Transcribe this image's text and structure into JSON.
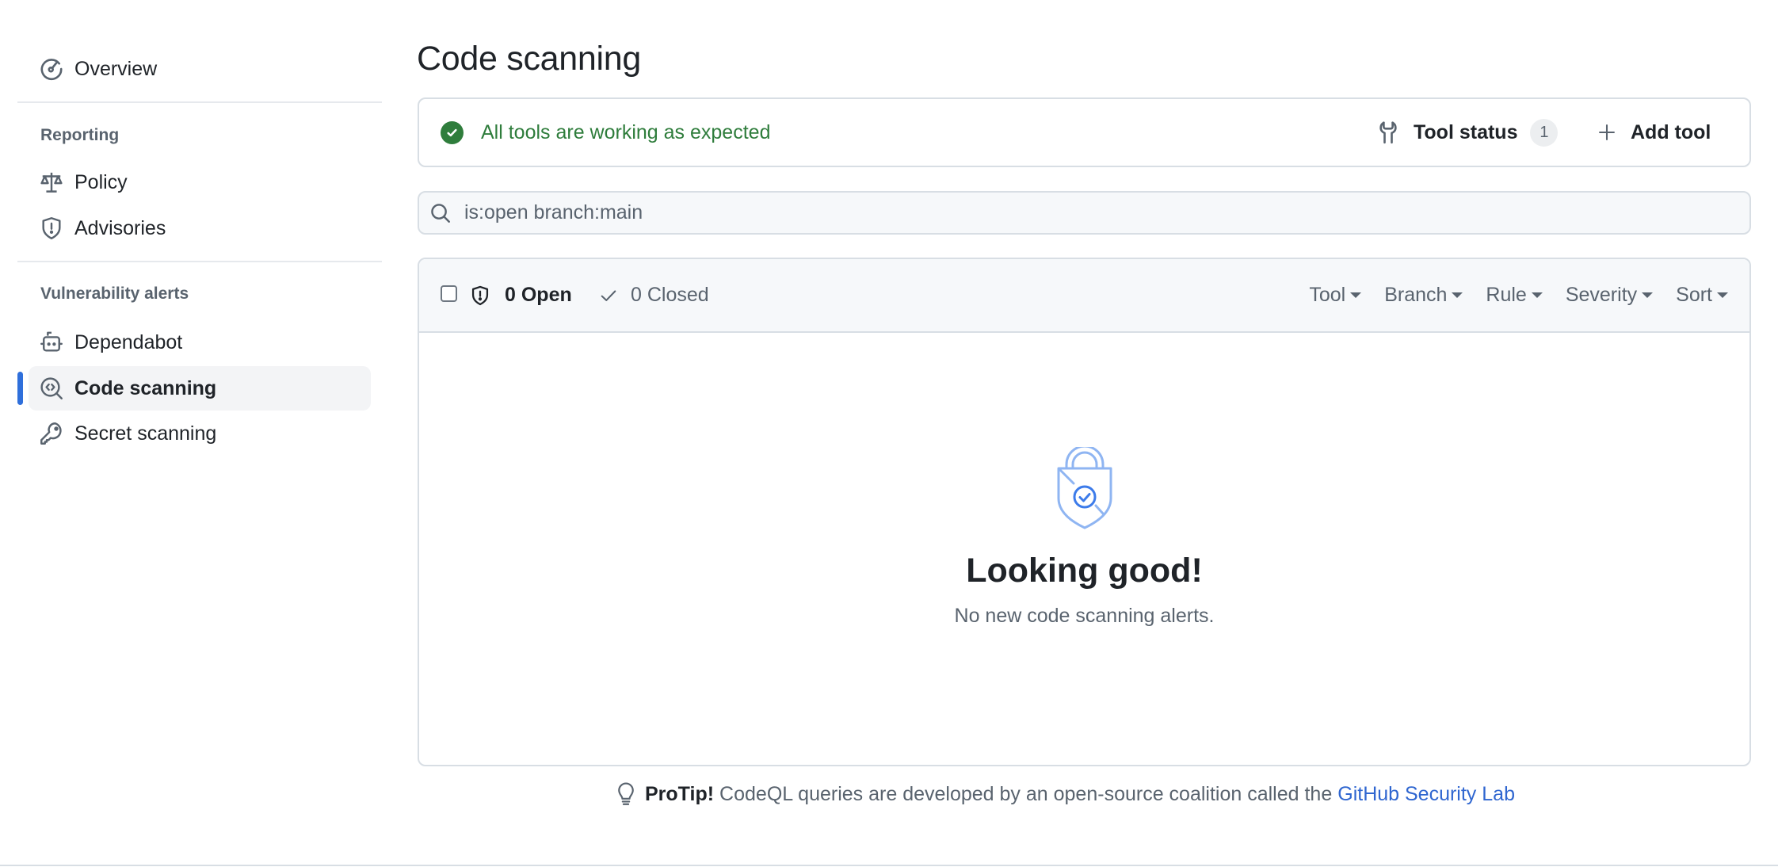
{
  "sidebar": {
    "overview": {
      "label": "Overview",
      "icon": "meter-icon"
    },
    "sections": [
      {
        "heading": "Reporting",
        "items": [
          {
            "label": "Policy",
            "icon": "law-icon"
          },
          {
            "label": "Advisories",
            "icon": "shield-alert-icon"
          }
        ]
      },
      {
        "heading": "Vulnerability alerts",
        "items": [
          {
            "label": "Dependabot",
            "icon": "dependabot-icon"
          },
          {
            "label": "Code scanning",
            "icon": "codescan-icon",
            "active": true
          },
          {
            "label": "Secret scanning",
            "icon": "key-icon"
          }
        ]
      }
    ]
  },
  "main": {
    "title": "Code scanning",
    "tools": {
      "status_text": "All tools are working as expected",
      "tool_status_label": "Tool status",
      "tool_status_count": "1",
      "add_tool_label": "Add tool"
    },
    "search": {
      "value": "is:open branch:main"
    },
    "alerts": {
      "open_label": "0 Open",
      "closed_label": "0 Closed",
      "filters": [
        "Tool",
        "Branch",
        "Rule",
        "Severity",
        "Sort"
      ],
      "empty_title": "Looking good!",
      "empty_subtitle": "No new code scanning alerts."
    },
    "protip": {
      "bold": "ProTip!",
      "text": "CodeQL queries are developed by an open-source coalition called the",
      "link": "GitHub Security Lab"
    }
  },
  "colors": {
    "accent": "#2f6fdb",
    "success": "#2f7d3c",
    "link": "#2f66d0",
    "muted": "#59636e"
  }
}
